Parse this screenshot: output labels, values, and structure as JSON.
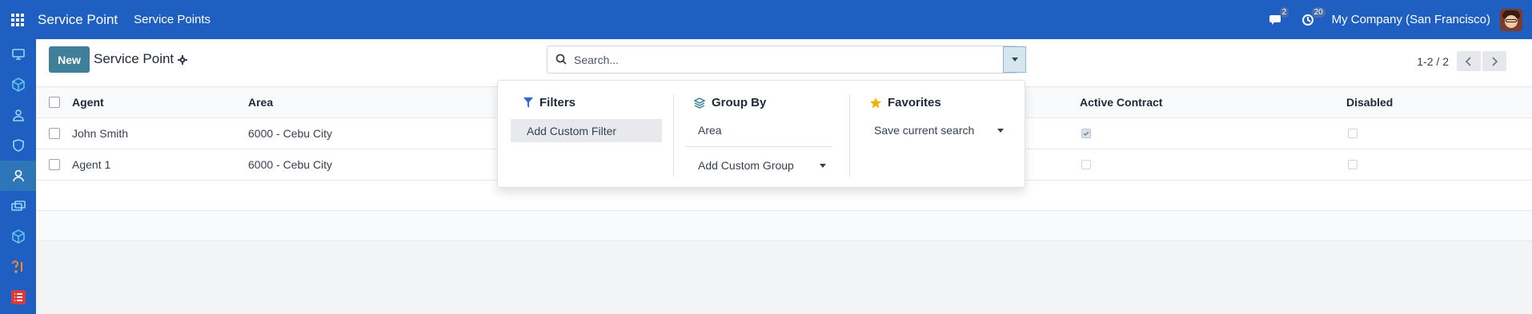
{
  "topbar": {
    "app_name": "Service Point",
    "menu_link": "Service Points",
    "messages_count": "2",
    "activities_count": "20",
    "company": "My Company (San Francisco)"
  },
  "control": {
    "new_label": "New",
    "breadcrumb": "Service Point",
    "search_placeholder": "Search...",
    "pager": "1-2 / 2"
  },
  "table": {
    "columns": [
      "Agent",
      "Area",
      "Active Contract",
      "Disabled"
    ],
    "rows": [
      {
        "agent": "John Smith",
        "area": "6000 - Cebu City",
        "active_contract": true,
        "disabled": false
      },
      {
        "agent": "Agent 1",
        "area": "6000 - Cebu City",
        "active_contract": false,
        "disabled": false
      }
    ]
  },
  "dropdown": {
    "filters": {
      "title": "Filters",
      "items": [
        "Add Custom Filter"
      ]
    },
    "group_by": {
      "title": "Group By",
      "items": [
        "Area"
      ],
      "add_custom": "Add Custom Group"
    },
    "favorites": {
      "title": "Favorites",
      "items": [
        "Save current search"
      ]
    }
  },
  "colors": {
    "brand": "#1f5fc1",
    "new_button": "#3f7f9a",
    "favorites_star": "#f0b400"
  }
}
